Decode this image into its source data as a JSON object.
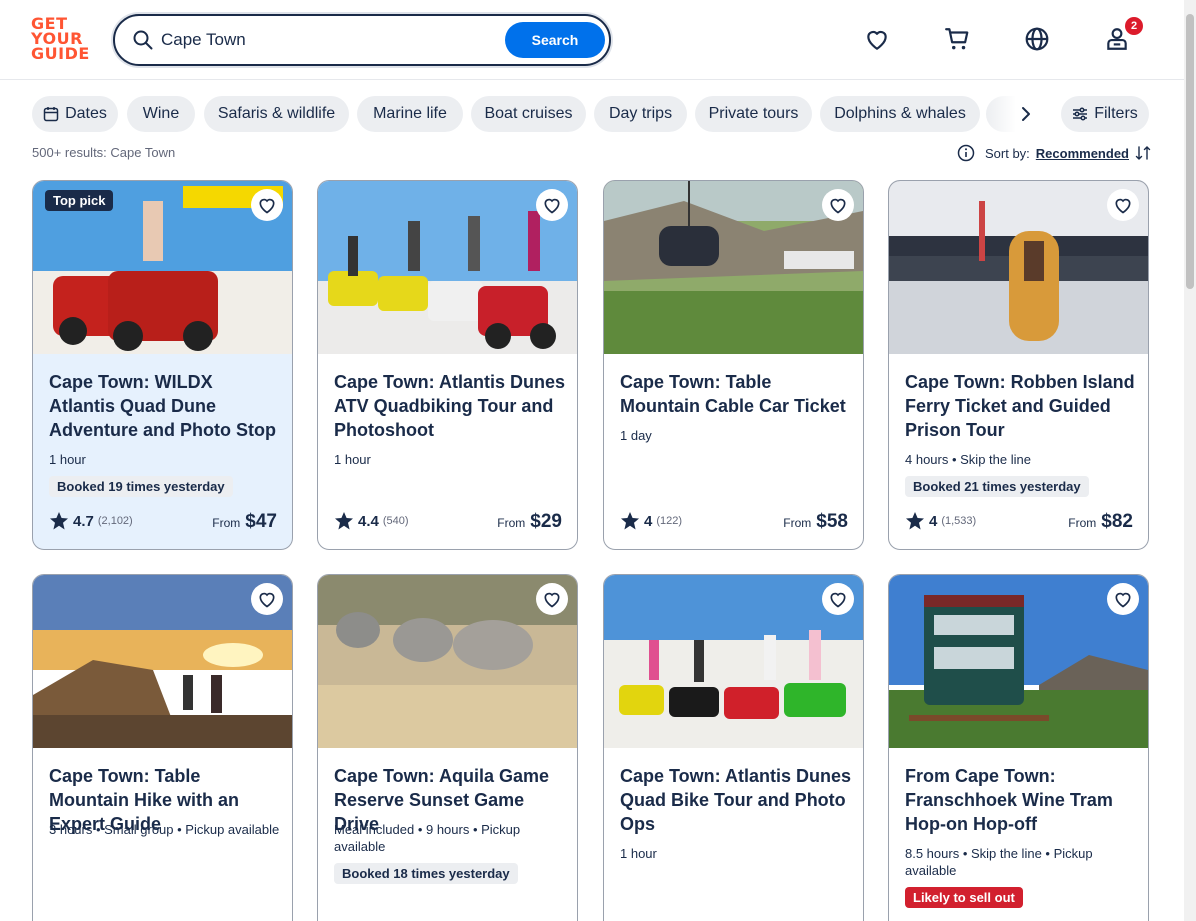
{
  "logo": {
    "line1": "GET",
    "line2": "YOUR",
    "line3": "GUIDE"
  },
  "search": {
    "value": "Cape Town",
    "button": "Search"
  },
  "header": {
    "cart_badge": "2"
  },
  "chips": {
    "dates": "Dates",
    "items": [
      "Wine",
      "Safaris & wildlife",
      "Marine life",
      "Boat cruises",
      "Day trips",
      "Private tours",
      "Dolphins & whales"
    ],
    "filters": "Filters"
  },
  "results": {
    "count_text": "500+ results: Cape Town",
    "sort_label": "Sort by:",
    "sort_value": "Recommended"
  },
  "cards": [
    {
      "title": "Cape Town: WILDX Atlantis Quad Dune Adventure and Photo Stop",
      "meta": "1 hour",
      "badge": "Top pick",
      "booked": "Booked 19 times yesterday",
      "rating": "4.7",
      "count": "(2,102)",
      "from": "From",
      "price": "$47"
    },
    {
      "title": "Cape Town: Atlantis Dunes ATV Quadbiking Tour and Photoshoot",
      "meta": "1 hour",
      "rating": "4.4",
      "count": "(540)",
      "from": "From",
      "price": "$29"
    },
    {
      "title": "Cape Town: Table Mountain Cable Car Ticket",
      "meta": "1 day",
      "rating": "4",
      "count": "(122)",
      "from": "From",
      "price": "$58"
    },
    {
      "title": "Cape Town: Robben Island Ferry Ticket and Guided Prison Tour",
      "meta": "4 hours • Skip the line",
      "booked": "Booked 21 times yesterday",
      "rating": "4",
      "count": "(1,533)",
      "from": "From",
      "price": "$82"
    },
    {
      "title": "Cape Town: Table Mountain Hike with an Expert Guide",
      "meta": "3 hours • Small group • Pickup available"
    },
    {
      "title": "Cape Town: Aquila Game Reserve Sunset Game Drive",
      "meta": "Meal included • 9 hours • Pickup available",
      "booked": "Booked 18 times yesterday"
    },
    {
      "title": "Cape Town: Atlantis Dunes Quad Bike Tour and Photo Ops",
      "meta": "1 hour"
    },
    {
      "title": "From Cape Town: Franschhoek Wine Tram Hop-on Hop-off",
      "meta": "8.5 hours • Skip the line • Pickup available",
      "likely": "Likely to sell out"
    }
  ],
  "colors": {
    "brand": "#ff5533",
    "accent": "#0071eb",
    "text": "#1a2b49",
    "highlight": "#e6f1fd",
    "alert": "#d2202e"
  }
}
